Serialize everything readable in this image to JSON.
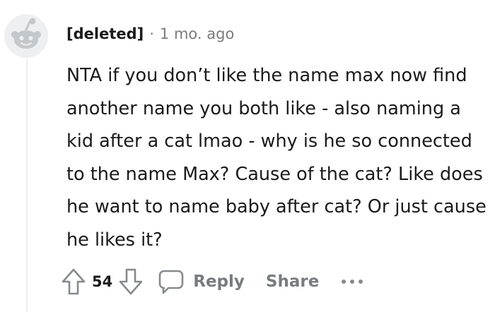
{
  "comment": {
    "author": "[deleted]",
    "separator": "·",
    "age": "1 mo. ago",
    "body": "NTA if you don’t like the name max now find another name you both like - also naming a kid after a cat lmao - why is he so connected to the name Max? Cause of the cat? Like does he want to name baby after cat? Or just cause he likes it?",
    "vote_count": "54",
    "reply_label": "Reply",
    "share_label": "Share"
  },
  "icons": {
    "avatar": "default-avatar-icon",
    "upvote": "upvote-arrow-icon",
    "downvote": "downvote-arrow-icon",
    "reply": "speech-bubble-icon",
    "more": "more-options-icon"
  },
  "colors": {
    "text": "#1a1a1b",
    "muted": "#787c7e",
    "avatar_bg": "#edeff1",
    "avatar_fg": "#c3c8cc"
  }
}
